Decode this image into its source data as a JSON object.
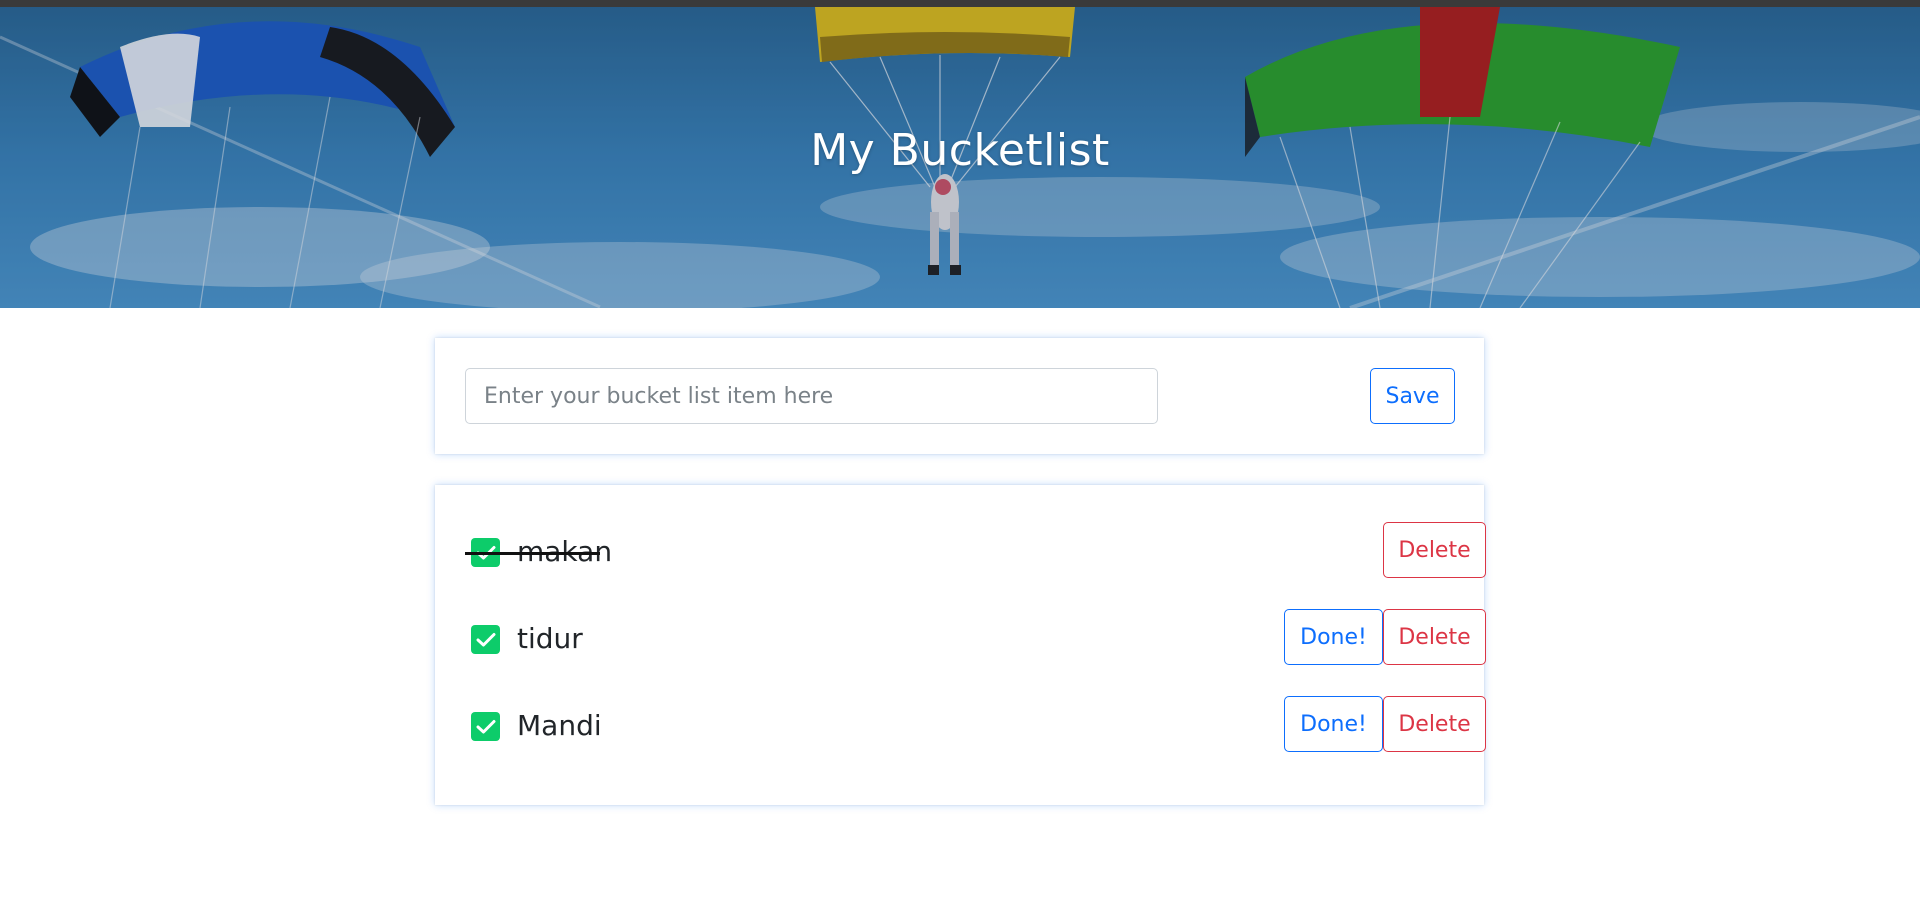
{
  "hero": {
    "title": "My Bucketlist"
  },
  "form": {
    "input_value": "",
    "placeholder": "Enter your bucket list item here",
    "save_label": "Save"
  },
  "list": {
    "items": [
      {
        "text": "makan",
        "completed": true,
        "done_label": "",
        "delete_label": "Delete"
      },
      {
        "text": "tidur",
        "completed": false,
        "done_label": "Done!",
        "delete_label": "Delete"
      },
      {
        "text": "Mandi",
        "completed": false,
        "done_label": "Done!",
        "delete_label": "Delete"
      }
    ]
  },
  "colors": {
    "primary": "#0d6efd",
    "danger": "#dc3545",
    "checkbox": "#0dcc6a"
  },
  "icons": {
    "checkbox": "check-icon",
    "hero_image": "parachutes-sky-image"
  }
}
